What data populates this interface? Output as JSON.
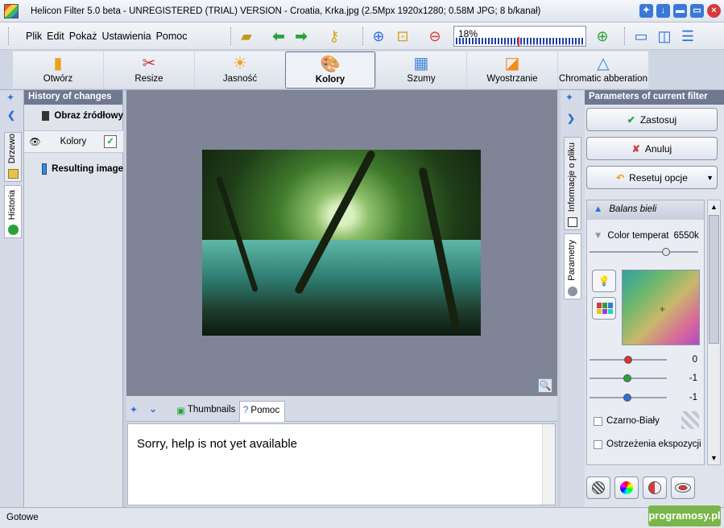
{
  "window": {
    "title": "Helicon Filter 5.0 beta - UNREGISTERED (TRIAL) VERSION - Croatia, Krka.jpg (2.5Mpx 1920x1280; 0.58M JPG; 8 b/kanał)"
  },
  "menu": [
    "Plik",
    "Edit",
    "Pokaż",
    "Ustawienia",
    "Pomoc"
  ],
  "toolbar": {
    "zoom_value": "18%",
    "zoom_level": 0.18
  },
  "filters": [
    {
      "label": "Otwórz",
      "icon": "folder-icon"
    },
    {
      "label": "Resize",
      "icon": "scissors-icon"
    },
    {
      "label": "Jasność",
      "icon": "sun-icon"
    },
    {
      "label": "Kolory",
      "icon": "palette-icon",
      "active": true
    },
    {
      "label": "Szumy",
      "icon": "noise-icon"
    },
    {
      "label": "Wyostrzanie",
      "icon": "sharpen-icon"
    },
    {
      "label": "Chromatic abberation",
      "icon": "prism-icon"
    }
  ],
  "left_tabs": {
    "tree": "Drzewo",
    "history": "Historia"
  },
  "history": {
    "title": "History of changes",
    "items": [
      "Obraz źródłowy",
      "Kolory",
      "Resulting image"
    ]
  },
  "bottom_tabs": {
    "thumbnails": "Thumbnails",
    "help": "Pomoc"
  },
  "help_text": "Sorry, help is not yet available",
  "right_tabs": {
    "file_info": "Informacje o pliku",
    "parameters": "Parametry"
  },
  "params": {
    "title": "Parameters of current filter",
    "apply": "Zastosuj",
    "cancel": "Anuluj",
    "reset": "Resetuj opcje",
    "group_title": "Balans bieli",
    "color_temp_label": "Color temperat",
    "color_temp_value": "6550k",
    "color_temp_level": 0.72,
    "rgb": [
      {
        "value": "0",
        "color": "#e03030",
        "level": 0.5
      },
      {
        "value": "-1",
        "color": "#2aa23a",
        "level": 0.49
      },
      {
        "value": "-1",
        "color": "#2f6fd8",
        "level": 0.49
      }
    ],
    "bw_label": "Czarno-Biały",
    "exposure_label": "Ostrzeżenia ekspozycji"
  },
  "status": {
    "text": "Gotowe",
    "badge": "programosy.pl"
  }
}
